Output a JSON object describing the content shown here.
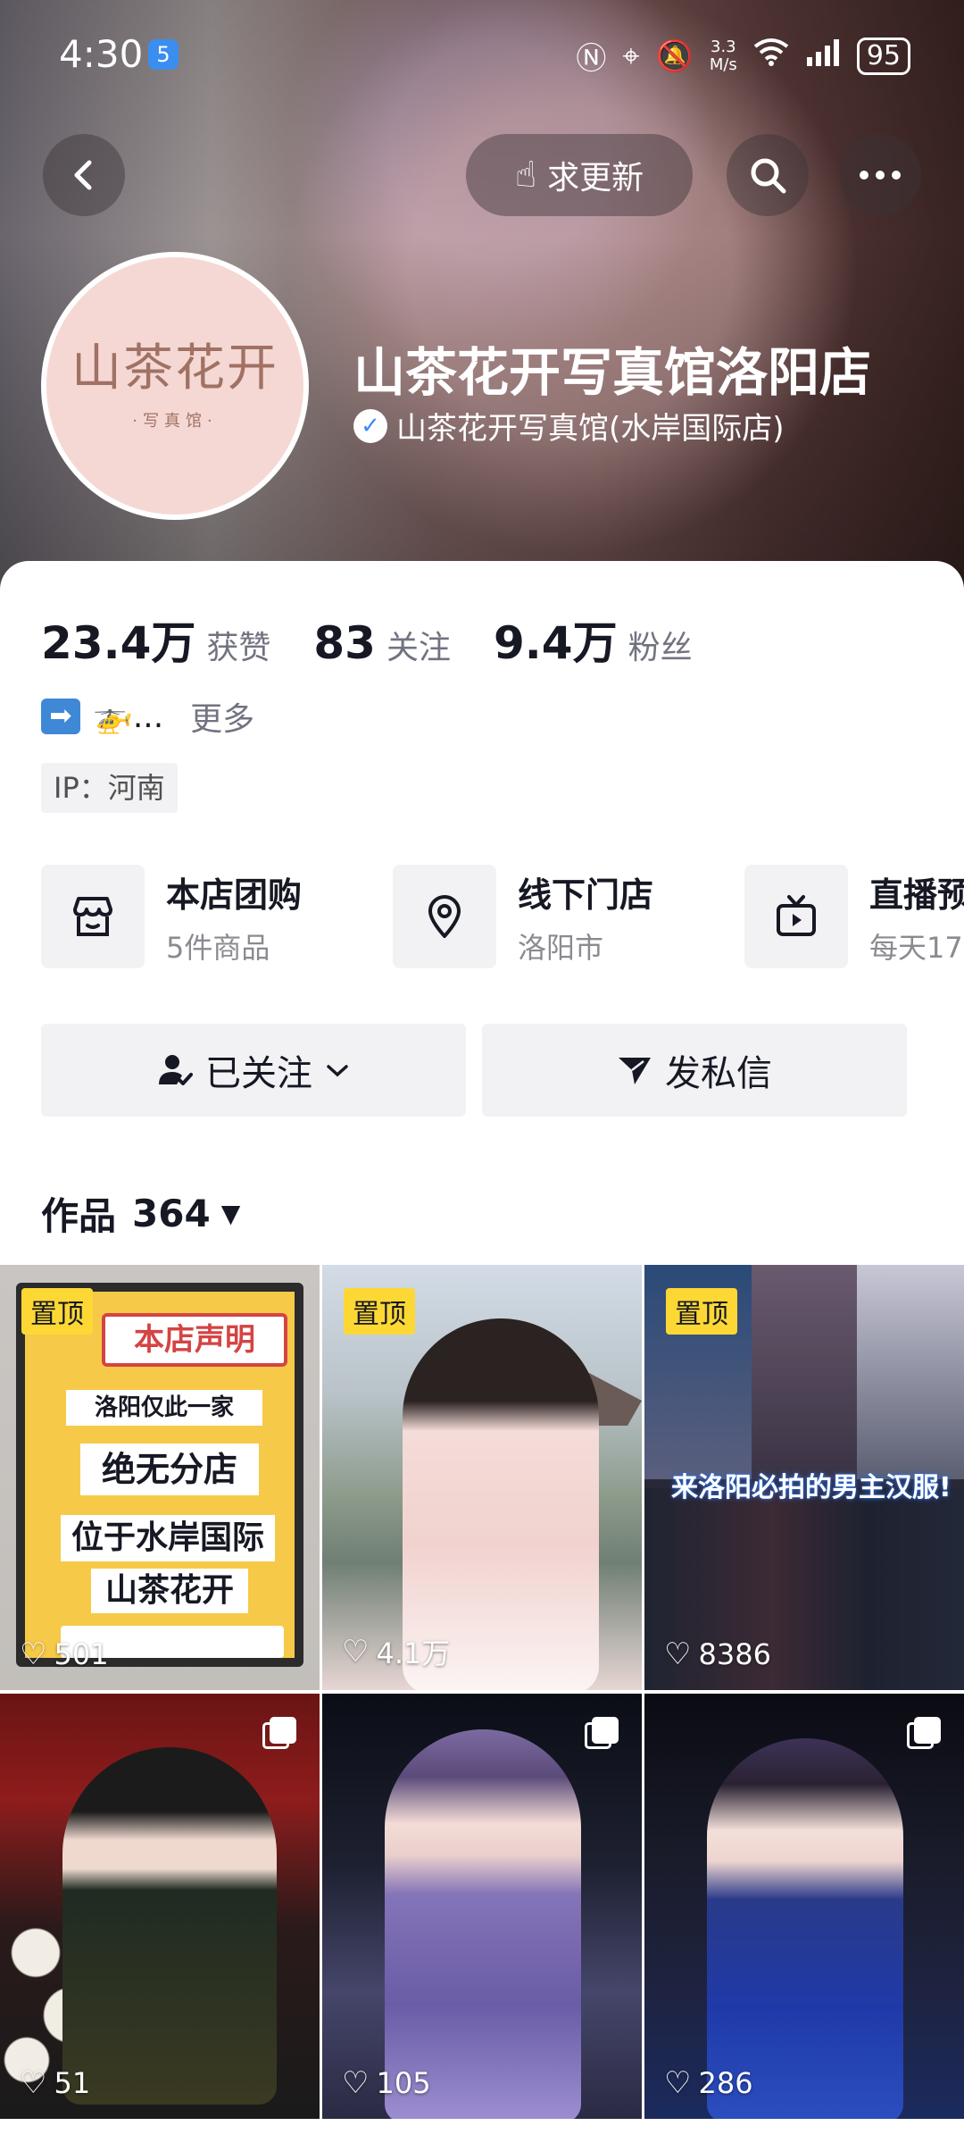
{
  "status_bar": {
    "time": "4:30",
    "app_badge": "5",
    "speed_top": "3.3",
    "speed_unit": "M/s",
    "battery": "95"
  },
  "nav": {
    "update_label": "求更新"
  },
  "profile": {
    "avatar_logo_main": "山茶花开",
    "avatar_logo_sub": "·写真馆·",
    "name": "山茶花开写真馆洛阳店",
    "verified_label": "山茶花开写真馆(水岸国际店)"
  },
  "stats": [
    {
      "value": "23.4万",
      "label": "获赞"
    },
    {
      "value": "83",
      "label": "关注"
    },
    {
      "value": "9.4万",
      "label": "粉丝"
    }
  ],
  "bio": {
    "arrow_glyph": "➡",
    "emoji": "🚁...",
    "more_label": "更多",
    "ip_label": "IP：河南"
  },
  "services": [
    {
      "title": "本店团购",
      "subtitle": "5件商品",
      "icon": "store-icon"
    },
    {
      "title": "线下门店",
      "subtitle": "洛阳市",
      "icon": "location-pin-icon"
    },
    {
      "title": "直播预",
      "subtitle": "每天17",
      "icon": "tv-icon"
    }
  ],
  "actions": {
    "follow_label": "已关注",
    "message_label": "发私信"
  },
  "works": {
    "label": "作品",
    "count": "364"
  },
  "grid": {
    "pin_label": "置顶",
    "items": [
      {
        "likes": "501",
        "pinned": true
      },
      {
        "likes": "4.1万",
        "pinned": true
      },
      {
        "likes": "8386",
        "pinned": true
      },
      {
        "likes": "51",
        "pinned": false
      },
      {
        "likes": "105",
        "pinned": false
      },
      {
        "likes": "286",
        "pinned": false
      }
    ],
    "poster1": {
      "title": "本店声明",
      "line1": "洛阳仅此一家",
      "line2": "绝无分店",
      "line3": "位于水岸国际",
      "line4": "山茶花开"
    },
    "poster3_text": "来洛阳必拍的男主汉服!"
  },
  "colors": {
    "pin_yellow": "#fdd835",
    "verify_blue": "#3d8af7",
    "button_gray": "#f2f2f4",
    "secondary_text": "#727380"
  }
}
